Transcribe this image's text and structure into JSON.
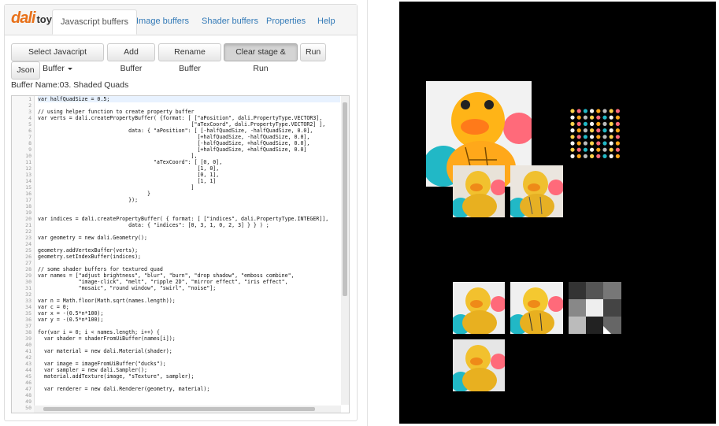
{
  "app": {
    "logo_primary": "dali",
    "logo_secondary": "toy"
  },
  "tabs": [
    {
      "label": "Javascript buffers",
      "active": true
    },
    {
      "label": "Image buffers",
      "active": false
    },
    {
      "label": "Shader buffers",
      "active": false
    },
    {
      "label": "Properties",
      "active": false
    },
    {
      "label": "Help",
      "active": false
    }
  ],
  "toolbar": {
    "select_label": "Select Javacript Buffer",
    "add_label": "Add Buffer",
    "rename_label": "Rename Buffer",
    "clear_run_label": "Clear stage & Run",
    "run_label": "Run",
    "json_label": "Json"
  },
  "buffer_name": "Buffer Name:03. Shaded Quads",
  "editor": {
    "line_numbers": [
      "1",
      "2",
      "3",
      "4",
      "5",
      "6",
      "7",
      "8",
      "9",
      "10",
      "11",
      "12",
      "13",
      "14",
      "15",
      "16",
      "17",
      "18",
      "19",
      "20",
      "21",
      "22",
      "23",
      "24",
      "25",
      "26",
      "27",
      "28",
      "29",
      "30",
      "31",
      "32",
      "33",
      "34",
      "35",
      "36",
      "37",
      "38",
      "39",
      "40",
      "41",
      "42",
      "43",
      "44",
      "45",
      "46",
      "47",
      "48",
      "49",
      "50"
    ],
    "lines": [
      "var halfQuadSize = 0.5;",
      "",
      "// using helper function to create property buffer",
      "var verts = dali.createPropertyBuffer( {format: [ [\"aPosition\", dali.PropertyType.VECTOR3],",
      "                                                 [\"aTexCoord\", dali.PropertyType.VECTOR2] ],",
      "                             data: { \"aPosition\": [ [-halfQuadSize, -halfQuadSize, 0.0],",
      "                                                   [+halfQuadSize, -halfQuadSize, 0.0],",
      "                                                   [-halfQuadSize, +halfQuadSize, 0.0],",
      "                                                   [+halfQuadSize, +halfQuadSize, 0.0]",
      "                                                 ],",
      "                                     \"aTexCoord\": [ [0, 0],",
      "                                                   [1, 0],",
      "                                                   [0, 1],",
      "                                                   [1, 1]",
      "                                                 ]",
      "                                   }",
      "                             });",
      "",
      "",
      "var indices = dali.createPropertyBuffer( { format: [ [\"indices\", dali.PropertyType.INTEGER]],",
      "                             data: { \"indices\": [0, 3, 1, 0, 2, 3] } } ) ;",
      "",
      "var geometry = new dali.Geometry();",
      "",
      "geometry.addVertexBuffer(verts);",
      "geometry.setIndexBuffer(indices);",
      "",
      "// some shader buffers for textured quad",
      "var names = [\"adjust brightness\", \"blur\", \"burn\", \"drop shadow\", \"emboss combine\",",
      "             \"image-click\", \"melt\", \"ripple 2D\", \"mirror effect\", \"iris effect\",",
      "             \"mosaic\", \"round window\", \"swirl\", \"noise\"];",
      "",
      "var n = Math.floor(Math.sqrt(names.length));",
      "var c = 0;",
      "var x = -(0.5*n*100);",
      "var y = -(0.5*n*100);",
      "",
      "for(var i = 0; i < names.length; i++) {",
      "  var shader = shaderFromUiBuffer(names[i]);",
      "",
      "  var material = new dali.Material(shader);",
      "",
      "  var image = imageFromUiBuffer(\"ducks\");",
      "  var sampler = new dali.Sampler();",
      "  material.addTexture(image, \"sTexture\", sampler);",
      "",
      "  var renderer = new dali.Renderer(geometry, material);",
      "",
      "",
      ""
    ]
  },
  "stage": {
    "background": "#000000"
  },
  "colors": {
    "link": "#337ab7",
    "logo_orange": "#e8711a"
  }
}
